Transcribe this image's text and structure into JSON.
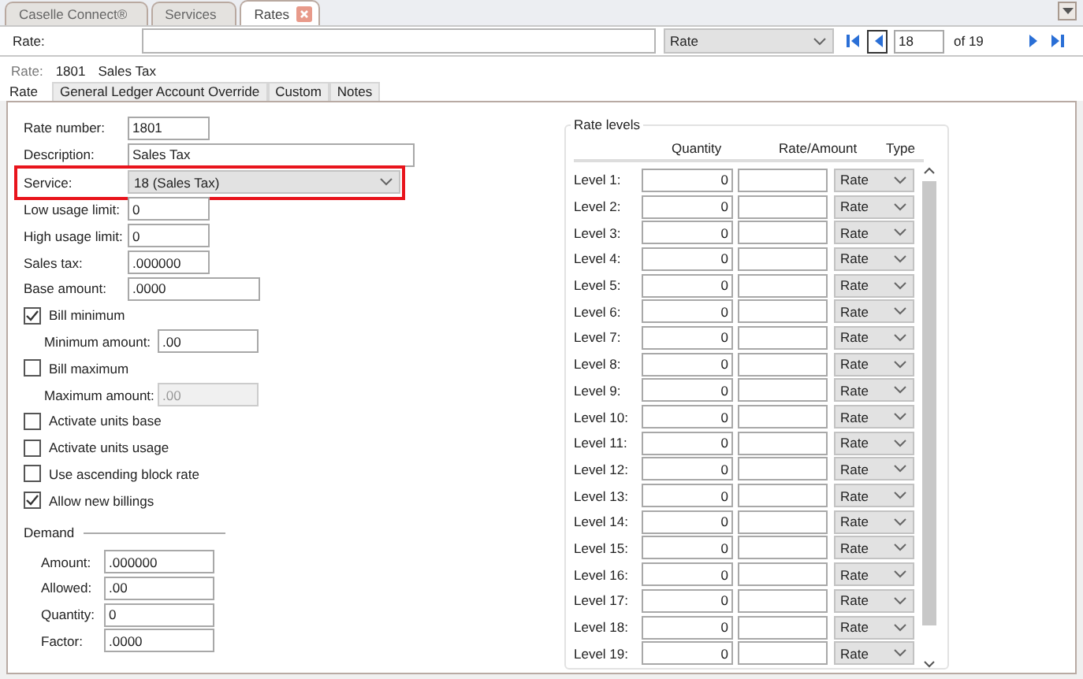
{
  "doc_tabs": [
    {
      "label": "Caselle Connect®",
      "selected": false,
      "closable": false
    },
    {
      "label": "Services",
      "selected": false,
      "closable": false
    },
    {
      "label": "Rates",
      "selected": true,
      "closable": true
    }
  ],
  "toolbar": {
    "label": "Rate:",
    "view": "Rate",
    "record": "18",
    "record_of": "of 19"
  },
  "record_header": {
    "label": "Rate:",
    "number": "1801",
    "name": "Sales Tax"
  },
  "tabs": [
    {
      "label": "Rate",
      "selected": true
    },
    {
      "label": "General Ledger Account Override",
      "selected": false
    },
    {
      "label": "Custom",
      "selected": false
    },
    {
      "label": "Notes",
      "selected": false
    }
  ],
  "form": [
    {
      "kind": "number",
      "label": "Rate number:",
      "value": "1801"
    },
    {
      "kind": "text",
      "label": "Description:",
      "value": "Sales Tax"
    },
    {
      "kind": "select",
      "label": "Service:",
      "value": "18 (Sales Tax)",
      "highlighted": true
    },
    {
      "kind": "number",
      "label": "Low usage limit:",
      "value": "0"
    },
    {
      "kind": "number",
      "label": "High usage limit:",
      "value": "0"
    },
    {
      "kind": "number",
      "label": "Sales tax:",
      "value": ".000000"
    },
    {
      "kind": "amount",
      "label": "Base amount:",
      "value": ".0000"
    },
    {
      "kind": "checkbox",
      "label": "Bill minimum",
      "checked": true
    },
    {
      "kind": "subfield",
      "label": "Minimum amount:",
      "value": ".00",
      "disabled": false
    },
    {
      "kind": "checkbox",
      "label": "Bill maximum",
      "checked": false
    },
    {
      "kind": "subfield",
      "label": "Maximum amount:",
      "value": ".00",
      "disabled": true
    },
    {
      "kind": "checkbox",
      "label": "Activate units base",
      "checked": false
    },
    {
      "kind": "checkbox",
      "label": "Activate units usage",
      "checked": false
    },
    {
      "kind": "checkbox",
      "label": "Use ascending block rate",
      "checked": false
    },
    {
      "kind": "checkbox",
      "label": "Allow new billings",
      "checked": true
    }
  ],
  "demand": {
    "title": "Demand",
    "fields": [
      {
        "label": "Amount:",
        "value": ".000000"
      },
      {
        "label": "Allowed:",
        "value": ".00"
      },
      {
        "label": "Quantity:",
        "value": "0"
      },
      {
        "label": "Factor:",
        "value": ".0000"
      }
    ]
  },
  "rate_levels": {
    "title": "Rate levels",
    "columns": [
      "Quantity",
      "Rate/Amount",
      "Type"
    ],
    "rows": [
      {
        "label": "Level 1:",
        "quantity": "0",
        "type": "Rate"
      },
      {
        "label": "Level 2:",
        "quantity": "0",
        "type": "Rate"
      },
      {
        "label": "Level 3:",
        "quantity": "0",
        "type": "Rate"
      },
      {
        "label": "Level 4:",
        "quantity": "0",
        "type": "Rate"
      },
      {
        "label": "Level 5:",
        "quantity": "0",
        "type": "Rate"
      },
      {
        "label": "Level 6:",
        "quantity": "0",
        "type": "Rate"
      },
      {
        "label": "Level 7:",
        "quantity": "0",
        "type": "Rate"
      },
      {
        "label": "Level 8:",
        "quantity": "0",
        "type": "Rate"
      },
      {
        "label": "Level 9:",
        "quantity": "0",
        "type": "Rate"
      },
      {
        "label": "Level 10:",
        "quantity": "0",
        "type": "Rate"
      },
      {
        "label": "Level 11:",
        "quantity": "0",
        "type": "Rate"
      },
      {
        "label": "Level 12:",
        "quantity": "0",
        "type": "Rate"
      },
      {
        "label": "Level 13:",
        "quantity": "0",
        "type": "Rate"
      },
      {
        "label": "Level 14:",
        "quantity": "0",
        "type": "Rate"
      },
      {
        "label": "Level 15:",
        "quantity": "0",
        "type": "Rate"
      },
      {
        "label": "Level 16:",
        "quantity": "0",
        "type": "Rate"
      },
      {
        "label": "Level 17:",
        "quantity": "0",
        "type": "Rate"
      },
      {
        "label": "Level 18:",
        "quantity": "0",
        "type": "Rate"
      },
      {
        "label": "Level 19:",
        "quantity": "0",
        "type": "Rate"
      }
    ]
  }
}
